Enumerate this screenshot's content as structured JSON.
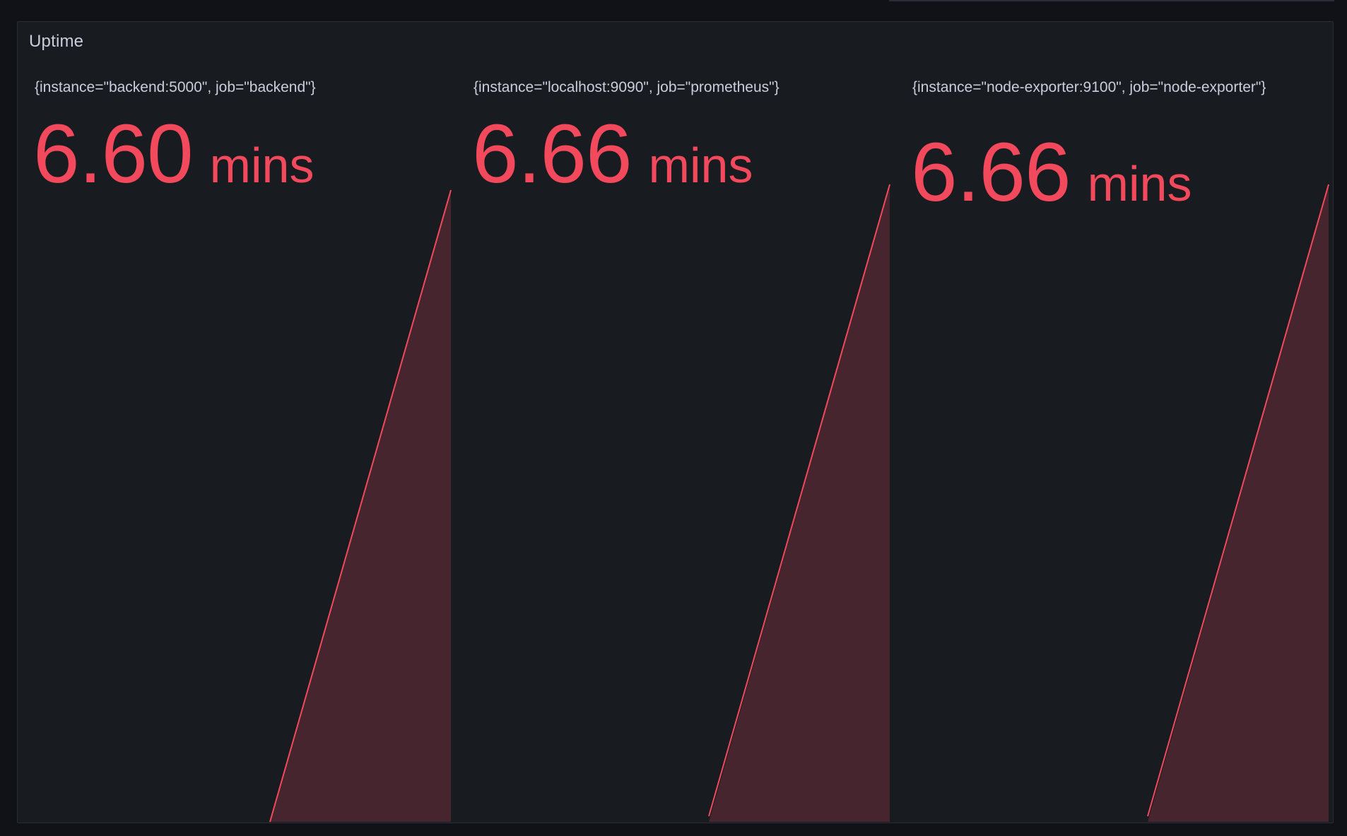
{
  "panel": {
    "title": "Uptime"
  },
  "stats": [
    {
      "label": "{instance=\"backend:5000\", job=\"backend\"}",
      "value": "6.60",
      "unit": "mins"
    },
    {
      "label": "{instance=\"localhost:9090\", job=\"prometheus\"}",
      "value": "6.66",
      "unit": "mins"
    },
    {
      "label": "{instance=\"node-exporter:9100\", job=\"node-exporter\"}",
      "value": "6.66",
      "unit": "mins"
    }
  ],
  "colors": {
    "value": "#f2495c",
    "sparkline_fill": "#46252e",
    "panel_bg": "#181b1f",
    "text": "#ccccdc"
  }
}
